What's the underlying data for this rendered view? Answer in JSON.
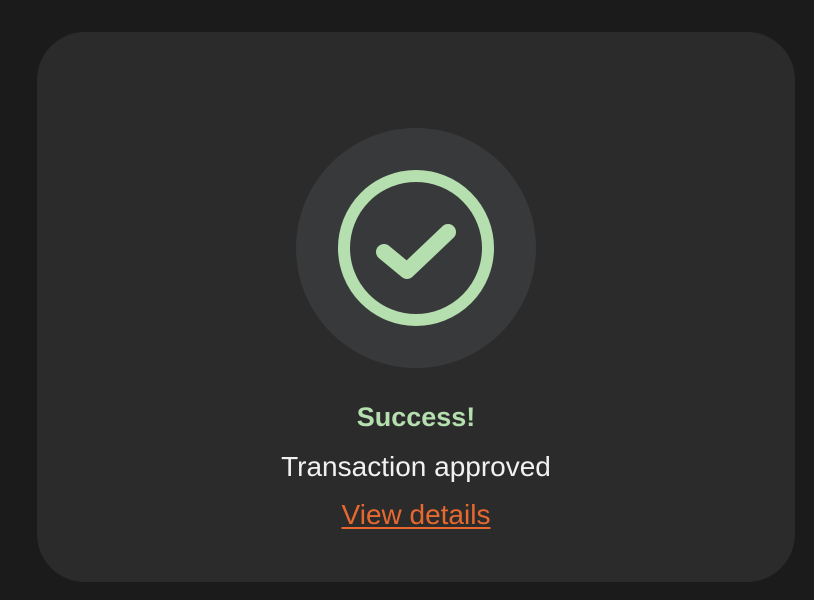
{
  "status": {
    "icon": "check-circle-icon",
    "title": "Success!",
    "message": "Transaction approved",
    "link_label": "View details"
  },
  "colors": {
    "page_background": "#1b1b1b",
    "card_background": "#2b2b2b",
    "icon_background": "#38393b",
    "success": "#b5dfae",
    "text": "#f1f1f1",
    "link": "#e8692f"
  }
}
